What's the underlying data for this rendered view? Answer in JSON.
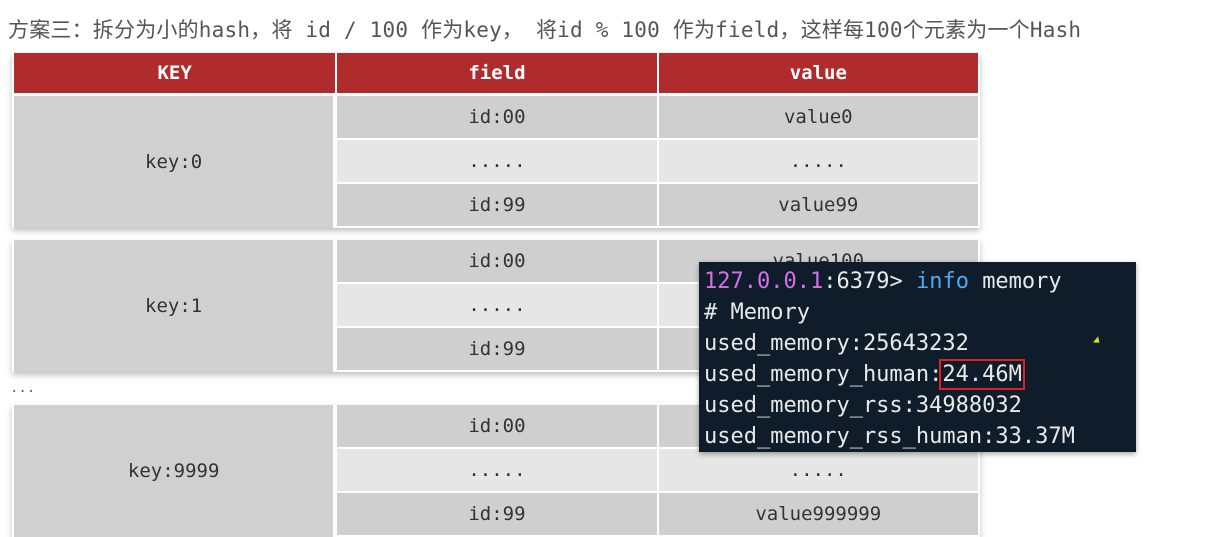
{
  "heading": "方案三：拆分为小的hash，将 id / 100 作为key， 将id % 100 作为field，这样每100个元素为一个Hash",
  "table_headers": {
    "key": "KEY",
    "field": "field",
    "value": "value"
  },
  "groups": [
    {
      "key": "key:0",
      "rows": [
        {
          "field": "id:00",
          "value": "value0"
        },
        {
          "field": ".....",
          "value": "....."
        },
        {
          "field": "id:99",
          "value": "value99"
        }
      ]
    },
    {
      "key": "key:1",
      "rows": [
        {
          "field": "id:00",
          "value": "value100"
        },
        {
          "field": ".....",
          "value": ""
        },
        {
          "field": "id:99",
          "value": ""
        }
      ]
    },
    {
      "key": "key:9999",
      "rows": [
        {
          "field": "id:00",
          "value": ""
        },
        {
          "field": ".....",
          "value": "....."
        },
        {
          "field": "id:99",
          "value": "value999999"
        }
      ]
    }
  ],
  "ellipsis": "...",
  "terminal": {
    "prompt_host": "127.0.0.1",
    "prompt_port": ":6379>",
    "command": "info",
    "command_arg": "memory",
    "lines": [
      "# Memory",
      "used_memory:25643232"
    ],
    "human_label": "used_memory_human:",
    "human_value": "24.46M",
    "lines_after": [
      "used_memory_rss:34988032",
      "used_memory_rss_human:33.37M"
    ]
  }
}
